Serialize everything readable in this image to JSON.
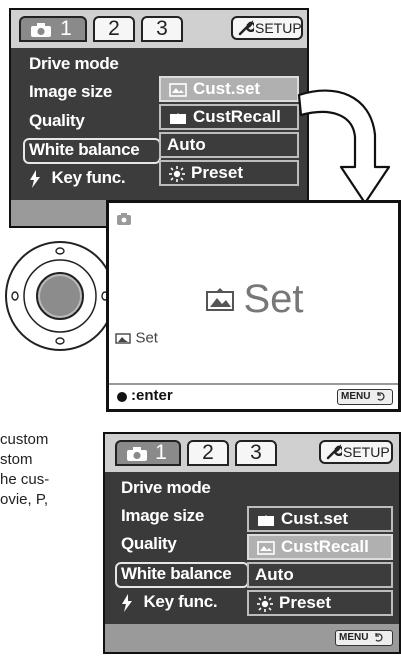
{
  "colors": {
    "screen_bg": "#3c3c3c",
    "tab_bar": "#d0d0d0",
    "selection": "#b0b0b0",
    "bottom_bar": "#9a9a9a"
  },
  "menu_top": {
    "tabs": [
      "1",
      "2",
      "3"
    ],
    "active_tab": "1",
    "setup_label": "SETUP",
    "items": [
      "Drive mode",
      "Image size",
      "Quality",
      "White balance",
      "Key func."
    ],
    "highlighted_item": "White balance",
    "key_func_icon": "lightning-icon",
    "options": [
      "Cust.set",
      "CustRecall",
      "Auto",
      "Preset"
    ],
    "selected_option": "Cust.set"
  },
  "preview": {
    "title": "Set",
    "small_label": "Set",
    "enter_label": ":enter",
    "menu_key": "MENU"
  },
  "menu_bottom": {
    "tabs": [
      "1",
      "2",
      "3"
    ],
    "active_tab": "1",
    "setup_label": "SETUP",
    "items": [
      "Drive mode",
      "Image size",
      "Quality",
      "White balance",
      "Key func."
    ],
    "highlighted_item": "White balance",
    "options": [
      "Cust.set",
      "CustRecall",
      "Auto",
      "Preset"
    ],
    "selected_option": "CustRecall",
    "menu_key": "MENU"
  },
  "caption_lines": [
    "custom",
    "stom",
    "he cus-",
    "ovie, P,"
  ]
}
